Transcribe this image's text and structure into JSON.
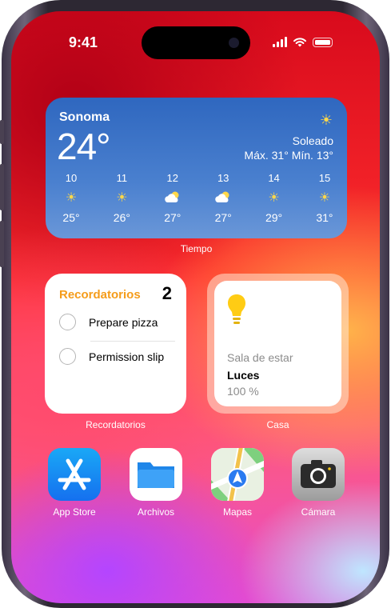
{
  "status": {
    "time": "9:41"
  },
  "weather": {
    "city": "Sonoma",
    "temp": "24°",
    "condition": "Soleado",
    "hilo": "Máx. 31° Mín. 13°",
    "days": [
      {
        "hour": "10",
        "icon": "sun-icon",
        "temp": "25°"
      },
      {
        "hour": "11",
        "icon": "sun-icon",
        "temp": "26°"
      },
      {
        "hour": "12",
        "icon": "partly-cloudy-icon",
        "temp": "27°"
      },
      {
        "hour": "13",
        "icon": "partly-cloudy-icon",
        "temp": "27°"
      },
      {
        "hour": "14",
        "icon": "sun-icon",
        "temp": "29°"
      },
      {
        "hour": "15",
        "icon": "sun-icon",
        "temp": "31°"
      }
    ],
    "label": "Tiempo"
  },
  "reminders": {
    "title": "Recordatorios",
    "count": "2",
    "items": [
      "Prepare pizza",
      "Permission slip"
    ],
    "label": "Recordatorios"
  },
  "home": {
    "room": "Sala de estar",
    "device": "Luces",
    "level": "100 %",
    "label": "Casa"
  },
  "dock": [
    {
      "name": "App Store",
      "icon": "app-store-icon"
    },
    {
      "name": "Archivos",
      "icon": "files-icon"
    },
    {
      "name": "Mapas",
      "icon": "maps-icon"
    },
    {
      "name": "Cámara",
      "icon": "camera-icon"
    }
  ],
  "colors": {
    "reminder_accent": "#f59c1a",
    "weather_top": "#2f67bf",
    "wallpaper_red": "#d80a1c"
  }
}
